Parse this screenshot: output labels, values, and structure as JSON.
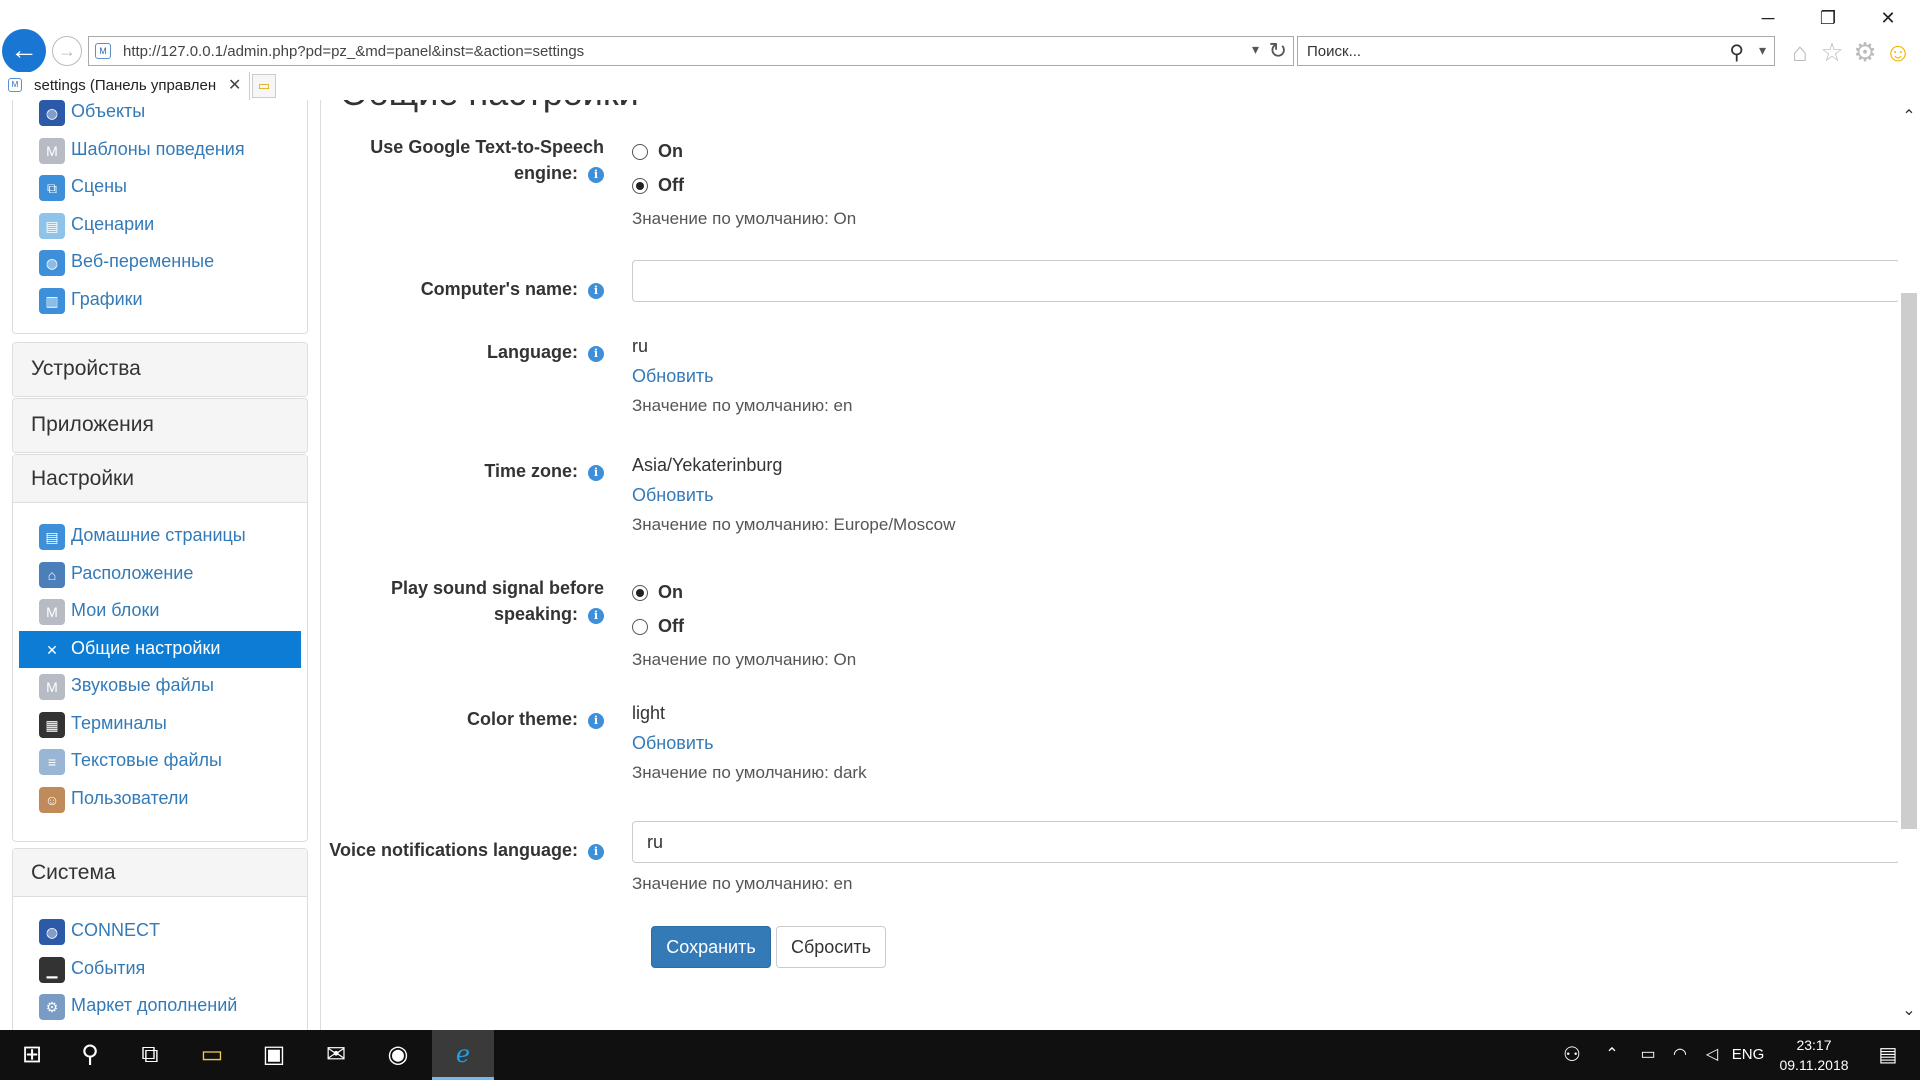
{
  "browser": {
    "url": "http://127.0.0.1/admin.php?pd=pz_&md=panel&inst=&action=settings",
    "search_placeholder": "Поиск...",
    "tab_title": "settings (Панель управлен"
  },
  "sidebar": {
    "top_items": [
      {
        "label": "Объекты",
        "icon": "globe-icon",
        "color": "#2a5aa8"
      },
      {
        "label": "Шаблоны поведения",
        "icon": "module-icon",
        "color": "#b7bcc4"
      },
      {
        "label": "Сцены",
        "icon": "scenes-icon",
        "color": "#3c8fd8"
      },
      {
        "label": "Сценарии",
        "icon": "scripts-icon",
        "color": "#8fc3ea"
      },
      {
        "label": "Веб-переменные",
        "icon": "web-globe-icon",
        "color": "#3c8fd8"
      },
      {
        "label": "Графики",
        "icon": "chart-icon",
        "color": "#3c8fd8"
      }
    ],
    "devices_heading": "Устройства",
    "apps_heading": "Приложения",
    "settings_heading": "Настройки",
    "settings_items": [
      {
        "label": "Домашние страницы",
        "icon": "page-icon",
        "color": "#3c8fd8"
      },
      {
        "label": "Расположение",
        "icon": "location-icon",
        "color": "#4a7fb9"
      },
      {
        "label": "Мои блоки",
        "icon": "module-icon",
        "color": "#b7bcc4"
      },
      {
        "label": "Общие настройки",
        "icon": "tools-icon",
        "color": "#0c7cd5",
        "active": true
      },
      {
        "label": "Звуковые файлы",
        "icon": "module-icon",
        "color": "#b7bcc4"
      },
      {
        "label": "Терминалы",
        "icon": "terminal-icon",
        "color": "#333333"
      },
      {
        "label": "Текстовые файлы",
        "icon": "text-files-icon",
        "color": "#9ab6d6"
      },
      {
        "label": "Пользователи",
        "icon": "users-icon",
        "color": "#c08a5a"
      }
    ],
    "system_heading": "Система",
    "system_items": [
      {
        "label": "CONNECT",
        "icon": "connect-globe-icon",
        "color": "#2a5aa8"
      },
      {
        "label": "События",
        "icon": "laptop-icon",
        "color": "#333333"
      },
      {
        "label": "Маркет дополнений",
        "icon": "market-icon",
        "color": "#7a9cc4"
      }
    ]
  },
  "main": {
    "page_title": "Общие настройки",
    "tts": {
      "label_line1": "Use Google Text-to-Speech",
      "label_line2": "engine:",
      "option_on": "On",
      "option_off": "Off",
      "selected": "Off",
      "default": "Значение по умолчанию: On"
    },
    "computer_name": {
      "label": "Computer's name:",
      "value": ""
    },
    "language": {
      "label": "Language:",
      "value": "ru",
      "update": "Обновить",
      "default": "Значение по умолчанию: en"
    },
    "timezone": {
      "label": "Time zone:",
      "value": "Asia/Yekaterinburg",
      "update": "Обновить",
      "default": "Значение по умолчанию: Europe/Moscow"
    },
    "sound_signal": {
      "label_line1": "Play sound signal before",
      "label_line2": "speaking:",
      "option_on": "On",
      "option_off": "Off",
      "selected": "On",
      "default": "Значение по умолчанию: On"
    },
    "color_theme": {
      "label": "Color theme:",
      "value": "light",
      "update": "Обновить",
      "default": "Значение по умолчанию: dark"
    },
    "voice_language": {
      "label": "Voice notifications language:",
      "value": "ru",
      "default": "Значение по умолчанию: en"
    },
    "save_label": "Сохранить",
    "reset_label": "Сбросить"
  },
  "taskbar": {
    "lang": "ENG",
    "time": "23:17",
    "date": "09.11.2018"
  }
}
